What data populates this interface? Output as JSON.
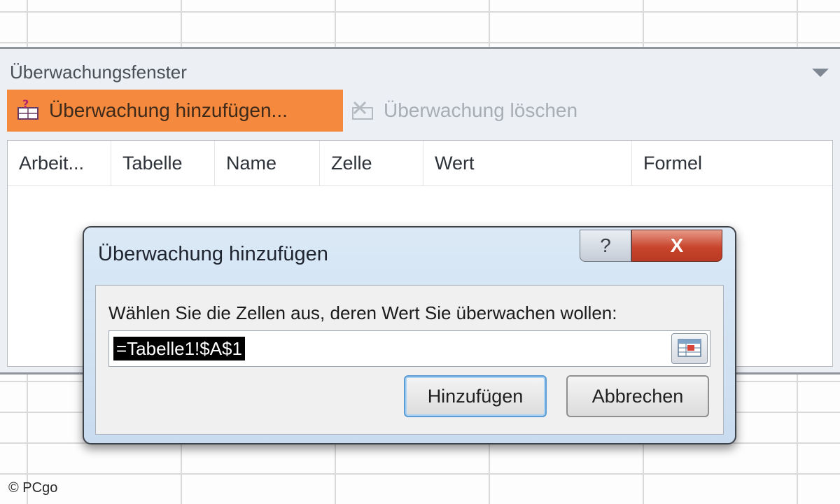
{
  "watch_window": {
    "title": "Überwachungsfenster",
    "add_watch_label": "Überwachung hinzufügen...",
    "delete_watch_label": "Überwachung löschen",
    "columns": [
      "Arbeit...",
      "Tabelle",
      "Name",
      "Zelle",
      "Wert",
      "Formel"
    ]
  },
  "dialog": {
    "title": "Überwachung hinzufügen",
    "help_label": "?",
    "close_label": "X",
    "prompt": "Wählen Sie die Zellen aus, deren Wert Sie überwachen wollen:",
    "reference_value": "=Tabelle1!$A$1",
    "add_button": "Hinzufügen",
    "cancel_button": "Abbrechen"
  },
  "watermark": "© PCgo",
  "colors": {
    "accent_hover": "#f5893e",
    "close_red": "#c8452c",
    "dialog_blue": "#c9dcef"
  }
}
